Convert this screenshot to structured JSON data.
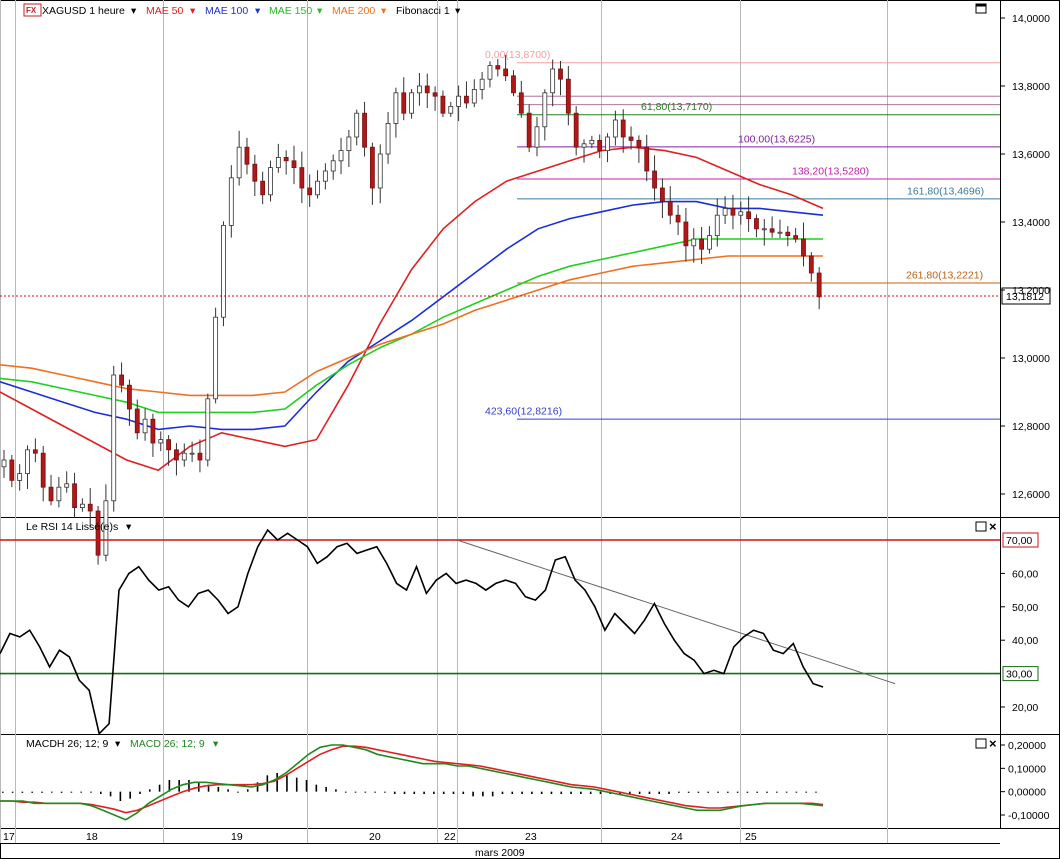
{
  "toolbar": {
    "instrument": "XAGUSD 1 heure",
    "mae50": "MAE 50",
    "mae100": "MAE 100",
    "mae150": "MAE 150",
    "mae200": "MAE 200",
    "fibonacci": "Fibonacci 1",
    "fx_badge": "FX"
  },
  "colors": {
    "mae50": "#e0201e",
    "mae100": "#1a2fd8",
    "mae150": "#20d020",
    "mae200": "#f07020",
    "rsi_line": "#000000",
    "rsi_upper": "#d01010",
    "rsi_lower": "#107010",
    "macdh": "#000000",
    "macd": "#1f8a1f",
    "signal": "#e02020"
  },
  "chart_data": [
    {
      "type": "candlestick",
      "title": "XAGUSD 1 heure",
      "yticks": [
        "14,0000",
        "13,8000",
        "13,6000",
        "13,4000",
        "13,2000",
        "13,0000",
        "12,8000",
        "12,6000"
      ],
      "ylim": [
        12.52,
        14.03
      ],
      "last_price": "13,1812",
      "fibonacci_levels": [
        {
          "label": "0,00(13,8700)",
          "value": 13.87,
          "color": "#f0a0a0"
        },
        {
          "label": "61,80(13,7170)",
          "value": 13.717,
          "color": "#208020"
        },
        {
          "label": "100,00(13,6225)",
          "value": 13.6225,
          "color": "#8020a0"
        },
        {
          "label": "138,20(13,5280)",
          "value": 13.528,
          "color": "#c020b0"
        },
        {
          "label": "161,80(13,4696)",
          "value": 13.4696,
          "color": "#3a7aa0"
        },
        {
          "label": "261,80(13,2221)",
          "value": 13.2221,
          "color": "#c06010"
        },
        {
          "label": "423,60(12,8216)",
          "value": 12.8216,
          "color": "#3040d0"
        }
      ],
      "extra_fib_lines": [
        13.77,
        13.745
      ],
      "moving_averages": [
        {
          "name": "MAE 50",
          "values": [
            12.9,
            12.85,
            12.8,
            12.75,
            12.7,
            12.67,
            12.74,
            12.78,
            12.76,
            12.74,
            12.76,
            12.92,
            13.1,
            13.26,
            13.38,
            13.46,
            13.52,
            13.55,
            13.58,
            13.61,
            13.62,
            13.61,
            13.59,
            13.55,
            13.51,
            13.48,
            13.44
          ]
        },
        {
          "name": "MAE 100",
          "values": [
            12.93,
            12.9,
            12.87,
            12.84,
            12.82,
            12.79,
            12.8,
            12.79,
            12.79,
            12.8,
            12.9,
            12.99,
            13.05,
            13.11,
            13.18,
            13.25,
            13.32,
            13.38,
            13.41,
            13.43,
            13.45,
            13.46,
            13.46,
            13.44,
            13.44,
            13.43,
            13.42
          ]
        },
        {
          "name": "MAE 150",
          "values": [
            12.94,
            12.93,
            12.91,
            12.89,
            12.87,
            12.84,
            12.84,
            12.84,
            12.84,
            12.85,
            12.92,
            12.98,
            13.03,
            13.07,
            13.12,
            13.16,
            13.2,
            13.24,
            13.27,
            13.29,
            13.31,
            13.33,
            13.35,
            13.35,
            13.35,
            13.35,
            13.35
          ]
        },
        {
          "name": "MAE 200",
          "values": [
            12.98,
            12.97,
            12.95,
            12.93,
            12.91,
            12.9,
            12.89,
            12.89,
            12.89,
            12.9,
            12.96,
            13.0,
            13.04,
            13.07,
            13.1,
            13.14,
            13.17,
            13.2,
            13.23,
            13.25,
            13.27,
            13.28,
            13.29,
            13.3,
            13.3,
            13.3,
            13.3
          ]
        }
      ],
      "close_path": [
        12.7,
        12.64,
        12.66,
        12.73,
        12.72,
        12.62,
        12.58,
        12.62,
        12.63,
        12.56,
        12.57,
        12.55,
        12.42,
        12.58,
        12.95,
        12.92,
        12.85,
        12.78,
        12.82,
        12.75,
        12.76,
        12.73,
        12.7,
        12.72,
        12.72,
        12.7,
        12.88,
        13.12,
        13.39,
        13.53,
        13.62,
        13.57,
        13.52,
        13.48,
        13.56,
        13.59,
        13.58,
        13.56,
        13.5,
        13.48,
        13.52,
        13.55,
        13.58,
        13.61,
        13.65,
        13.72,
        13.62,
        13.5,
        13.6,
        13.69,
        13.78,
        13.72,
        13.78,
        13.8,
        13.78,
        13.77,
        13.72,
        13.74,
        13.77,
        13.75,
        13.79,
        13.82,
        13.86,
        13.85,
        13.83,
        13.78,
        13.72,
        13.62,
        13.68,
        13.78,
        13.85,
        13.82,
        13.72,
        13.62,
        13.63,
        13.64,
        13.61,
        13.65,
        13.7,
        13.65,
        13.64,
        13.62,
        13.55,
        13.5,
        13.46,
        13.42,
        13.4,
        13.33,
        13.35,
        13.32,
        13.36,
        13.42,
        13.44,
        13.42,
        13.43,
        13.41,
        13.38,
        13.38,
        13.37,
        13.37,
        13.36,
        13.35,
        13.3,
        13.25,
        13.18
      ]
    },
    {
      "type": "line",
      "title": "Le RSI 14 Lissé(e)s",
      "yticks": [
        "60,00",
        "50,00",
        "40,00",
        "20,00"
      ],
      "ylim": [
        13,
        77
      ],
      "upper_level": {
        "label": "70,00",
        "value": 70
      },
      "lower_level": {
        "label": "30,00",
        "value": 30
      },
      "trendline": [
        {
          "x": 457,
          "y": 70
        },
        {
          "x": 895,
          "y": 27
        }
      ],
      "values": [
        36,
        42,
        41,
        43,
        38,
        32,
        37,
        35,
        28,
        25,
        12,
        15,
        55,
        60,
        62,
        58,
        55,
        56,
        52,
        50,
        54,
        55,
        52,
        48,
        50,
        60,
        68,
        73,
        70,
        72,
        70,
        68,
        63,
        65,
        68,
        69,
        66,
        67,
        68,
        63,
        57,
        55,
        62,
        54,
        58,
        60,
        57,
        58,
        57,
        55,
        57,
        58,
        57,
        53,
        52,
        55,
        64,
        65,
        58,
        55,
        50,
        43,
        48,
        45,
        42,
        46,
        51,
        45,
        40,
        36,
        34,
        30,
        31,
        30,
        38,
        41,
        43,
        42,
        37,
        36,
        39,
        32,
        27,
        26
      ]
    },
    {
      "type": "bar+line",
      "title": "MACDH 26; 12; 9",
      "series_titles": [
        "MACDH 26; 12; 9",
        "MACD 26; 12; 9"
      ],
      "yticks": [
        "0,20000",
        "0,10000",
        "0,00000",
        "-0,10000"
      ],
      "ylim": [
        -0.15,
        0.22
      ],
      "macdh": [
        -0.005,
        -0.005,
        -0.005,
        -0.005,
        -0.005,
        -0.004,
        -0.005,
        -0.004,
        -0.003,
        -0.003,
        -0.01,
        -0.02,
        -0.04,
        -0.03,
        -0.01,
        0.01,
        0.03,
        0.05,
        0.05,
        0.05,
        0.04,
        0.03,
        0.02,
        0.01,
        0.0,
        0.01,
        0.04,
        0.07,
        0.08,
        0.07,
        0.06,
        0.05,
        0.03,
        0.02,
        0.01,
        0.0,
        0.0,
        0.0,
        0.0,
        0.0,
        -0.01,
        -0.01,
        -0.01,
        -0.01,
        -0.01,
        -0.01,
        -0.01,
        -0.01,
        -0.02,
        -0.02,
        -0.02,
        -0.01,
        -0.01,
        -0.01,
        -0.01,
        -0.01,
        -0.01,
        -0.01,
        -0.01,
        -0.01,
        -0.01,
        -0.01,
        -0.01,
        -0.01,
        -0.01,
        -0.01,
        -0.01,
        -0.01,
        -0.01,
        -0.005,
        -0.005,
        -0.005,
        -0.005,
        -0.005,
        -0.005,
        -0.005,
        -0.005,
        -0.005,
        -0.005,
        0.0,
        0.0,
        0.0,
        0.0,
        0.0
      ],
      "macd": [
        -0.04,
        -0.04,
        -0.04,
        -0.05,
        -0.05,
        -0.05,
        -0.05,
        -0.05,
        -0.06,
        -0.08,
        -0.1,
        -0.12,
        -0.09,
        -0.05,
        -0.02,
        0.01,
        0.03,
        0.04,
        0.04,
        0.035,
        0.03,
        0.025,
        0.02,
        0.03,
        0.05,
        0.08,
        0.12,
        0.16,
        0.19,
        0.2,
        0.2,
        0.19,
        0.18,
        0.16,
        0.15,
        0.14,
        0.13,
        0.12,
        0.12,
        0.12,
        0.11,
        0.11,
        0.1,
        0.09,
        0.08,
        0.07,
        0.06,
        0.05,
        0.04,
        0.03,
        0.02,
        0.015,
        0.01,
        0.0,
        -0.01,
        -0.02,
        -0.03,
        -0.04,
        -0.05,
        -0.06,
        -0.07,
        -0.08,
        -0.08,
        -0.08,
        -0.07,
        -0.06,
        -0.055,
        -0.05,
        -0.05,
        -0.05,
        -0.05,
        -0.055,
        -0.06
      ],
      "signal": [
        -0.04,
        -0.04,
        -0.045,
        -0.045,
        -0.05,
        -0.05,
        -0.05,
        -0.05,
        -0.055,
        -0.065,
        -0.075,
        -0.09,
        -0.08,
        -0.06,
        -0.04,
        -0.02,
        0.0,
        0.015,
        0.025,
        0.03,
        0.03,
        0.03,
        0.03,
        0.035,
        0.045,
        0.07,
        0.1,
        0.13,
        0.16,
        0.18,
        0.195,
        0.195,
        0.19,
        0.18,
        0.17,
        0.16,
        0.15,
        0.14,
        0.13,
        0.125,
        0.12,
        0.115,
        0.11,
        0.1,
        0.09,
        0.08,
        0.07,
        0.06,
        0.05,
        0.04,
        0.03,
        0.025,
        0.02,
        0.01,
        0.0,
        -0.01,
        -0.02,
        -0.03,
        -0.04,
        -0.05,
        -0.06,
        -0.065,
        -0.07,
        -0.07,
        -0.065,
        -0.06,
        -0.055,
        -0.05,
        -0.05,
        -0.05,
        -0.05,
        -0.05,
        -0.055
      ]
    }
  ],
  "xaxis": {
    "labels": [
      {
        "text": "17",
        "x": 0
      },
      {
        "text": "18",
        "x": 83
      },
      {
        "text": "19",
        "x": 228
      },
      {
        "text": "20",
        "x": 366
      },
      {
        "text": "22",
        "x": 441
      },
      {
        "text": "23",
        "x": 522
      },
      {
        "text": "24",
        "x": 668
      },
      {
        "text": "25",
        "x": 742
      }
    ],
    "month": "mars 2009"
  }
}
